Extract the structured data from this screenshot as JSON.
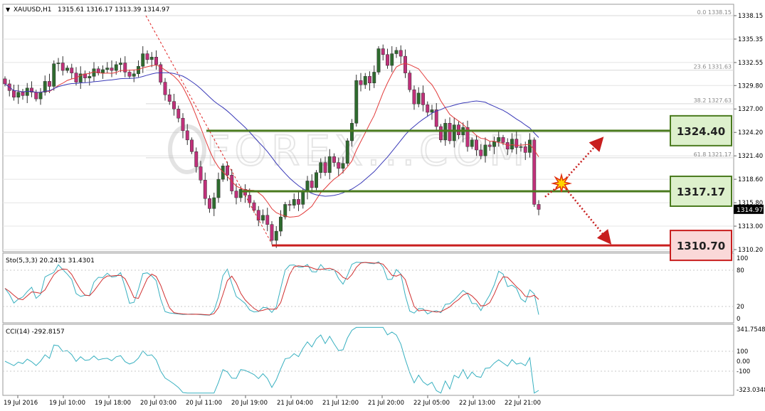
{
  "header": {
    "arrow": "▼",
    "symbol": "XAUUSD,H1",
    "ohlc": "1315.61 1316.17 1313.39 1314.97"
  },
  "price_axis": {
    "ticks": [
      "1338.15",
      "1335.35",
      "1332.55",
      "1329.80",
      "1327.00",
      "1324.20",
      "1321.40",
      "1318.60",
      "1315.80",
      "1313.00",
      "1310.20"
    ],
    "current_price": "1314.97"
  },
  "fibonacci": [
    {
      "label": "0.0 1338.15",
      "price": 1338.15
    },
    {
      "label": "23.6 1331.63",
      "price": 1331.63
    },
    {
      "label": "38.2 1327.63",
      "price": 1327.63
    },
    {
      "label": "61.8 1321.17",
      "price": 1321.17
    }
  ],
  "levels": [
    {
      "label": "1324.40",
      "price": 1324.4,
      "kind": "resistance"
    },
    {
      "label": "1317.17",
      "price": 1317.17,
      "kind": "pivot"
    },
    {
      "label": "1310.70",
      "price": 1310.7,
      "kind": "support"
    }
  ],
  "watermark": "FOREX...COM",
  "stochastic": {
    "label": "Sto(5,3,3) 20.2431 31.4301",
    "ticks": [
      "100",
      "80",
      "20",
      "0"
    ]
  },
  "cci": {
    "label": "CCI(14) -292.8157",
    "ticks": [
      "341.7548",
      "100",
      "0.00",
      "-100",
      "-323.0348"
    ]
  },
  "time_axis": {
    "labels": [
      "19 Jul 2016",
      "19 Jul 10:00",
      "19 Jul 18:00",
      "20 Jul 03:00",
      "20 Jul 11:00",
      "20 Jul 19:00",
      "21 Jul 04:00",
      "21 Jul 12:00",
      "21 Jul 20:00",
      "22 Jul 05:00",
      "22 Jul 13:00",
      "22 Jul 21:00"
    ]
  },
  "colors": {
    "bull": "#2e6b2e",
    "bear": "#c0307a",
    "ma_fast": "#e23b3b",
    "ma_slow": "#3a3ab8",
    "stoch_main": "#38b0c0",
    "stoch_signal": "#d03030",
    "level_green": "#4a7a1e",
    "level_red": "#c81e1e",
    "label_green_bg": "#ddf0cc",
    "label_red_bg": "#fad8d8"
  },
  "chart_data": {
    "type": "candlestick",
    "symbol": "XAUUSD",
    "timeframe": "H1",
    "ylim": [
      1309.5,
      1339.5
    ],
    "closes": [
      1330,
      1329.2,
      1328.4,
      1329,
      1328.6,
      1329.5,
      1329,
      1328.2,
      1329,
      1330.3,
      1329.7,
      1332.4,
      1332.5,
      1331.6,
      1331.9,
      1331.3,
      1330.2,
      1331.2,
      1330.7,
      1330.9,
      1331.8,
      1331.3,
      1331.7,
      1331.9,
      1331.6,
      1332.3,
      1332.5,
      1331.4,
      1330.9,
      1331.2,
      1332.1,
      1333.6,
      1332.9,
      1333.2,
      1332.3,
      1330.2,
      1328.7,
      1327.9,
      1327,
      1325.9,
      1324.4,
      1323.3,
      1321.9,
      1320.1,
      1318.5,
      1316.3,
      1315.1,
      1316.4,
      1318.6,
      1320.2,
      1319.1,
      1317.2,
      1316.4,
      1317.4,
      1316.7,
      1315.8,
      1314.9,
      1313.7,
      1314.3,
      1313.2,
      1311.3,
      1312.4,
      1314.1,
      1315.6,
      1315.5,
      1316.2,
      1315.6,
      1317.1,
      1318.4,
      1317.6,
      1319.4,
      1320.6,
      1319.4,
      1321.3,
      1320.6,
      1319.9,
      1320.5,
      1323.2,
      1325.3,
      1330.4,
      1329.9,
      1330.9,
      1330.1,
      1331.4,
      1334.2,
      1333.5,
      1332.2,
      1333.6,
      1334,
      1333.3,
      1331.3,
      1329.3,
      1327.6,
      1328.9,
      1327.5,
      1326.6,
      1326.9,
      1324.9,
      1323.3,
      1325.3,
      1323.2,
      1325.1,
      1323.9,
      1324.8,
      1322.5,
      1323.3,
      1322.1,
      1321.4,
      1322.7,
      1322.5,
      1323.1,
      1323.6,
      1323,
      1322.2,
      1323.4,
      1322.4,
      1322.5,
      1321.8,
      1323.3,
      1315.6,
      1315
    ],
    "levels": [
      1324.4,
      1317.17,
      1310.7
    ],
    "fibonacci": {
      "0.0": 1338.15,
      "23.6": 1331.63,
      "38.2": 1327.63,
      "61.8": 1321.17
    },
    "stochastic": {
      "k": 20.2431,
      "d": 31.4301,
      "ylim": [
        0,
        100
      ]
    },
    "cci": {
      "value": -292.8157,
      "ylim": [
        -323.0348,
        341.7548
      ]
    }
  }
}
